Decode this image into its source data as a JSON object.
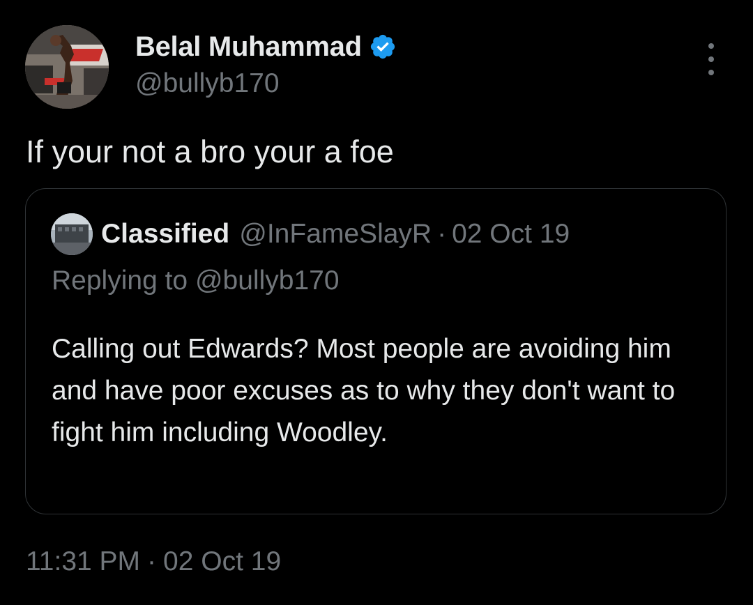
{
  "author": {
    "name": "Belal Muhammad",
    "handle": "@bullyb170",
    "avatar_icon": "fighter-avatar-photo",
    "verified_icon": "verified-badge-icon",
    "verified_color": "#1d9bf0"
  },
  "tweet": {
    "text": "If your not a bro your a foe",
    "time": "11:31 PM",
    "separator": "·",
    "date": "02 Oct 19"
  },
  "quoted_tweet": {
    "name": "Classified",
    "handle": "@InFameSlayR",
    "separator": "·",
    "date": "02 Oct 19",
    "replying_to": "Replying to @bullyb170",
    "text": "Calling out Edwards? Most people are avoiding him and have poor excuses as to why they don't want to fight him including Woodley.",
    "avatar_icon": "building-avatar-photo"
  },
  "icons": {
    "more": "more-options-icon"
  },
  "colors": {
    "background": "#000000",
    "text_primary": "#e7e9ea",
    "text_secondary": "#71767b",
    "border": "#2f3336",
    "accent": "#1d9bf0"
  }
}
